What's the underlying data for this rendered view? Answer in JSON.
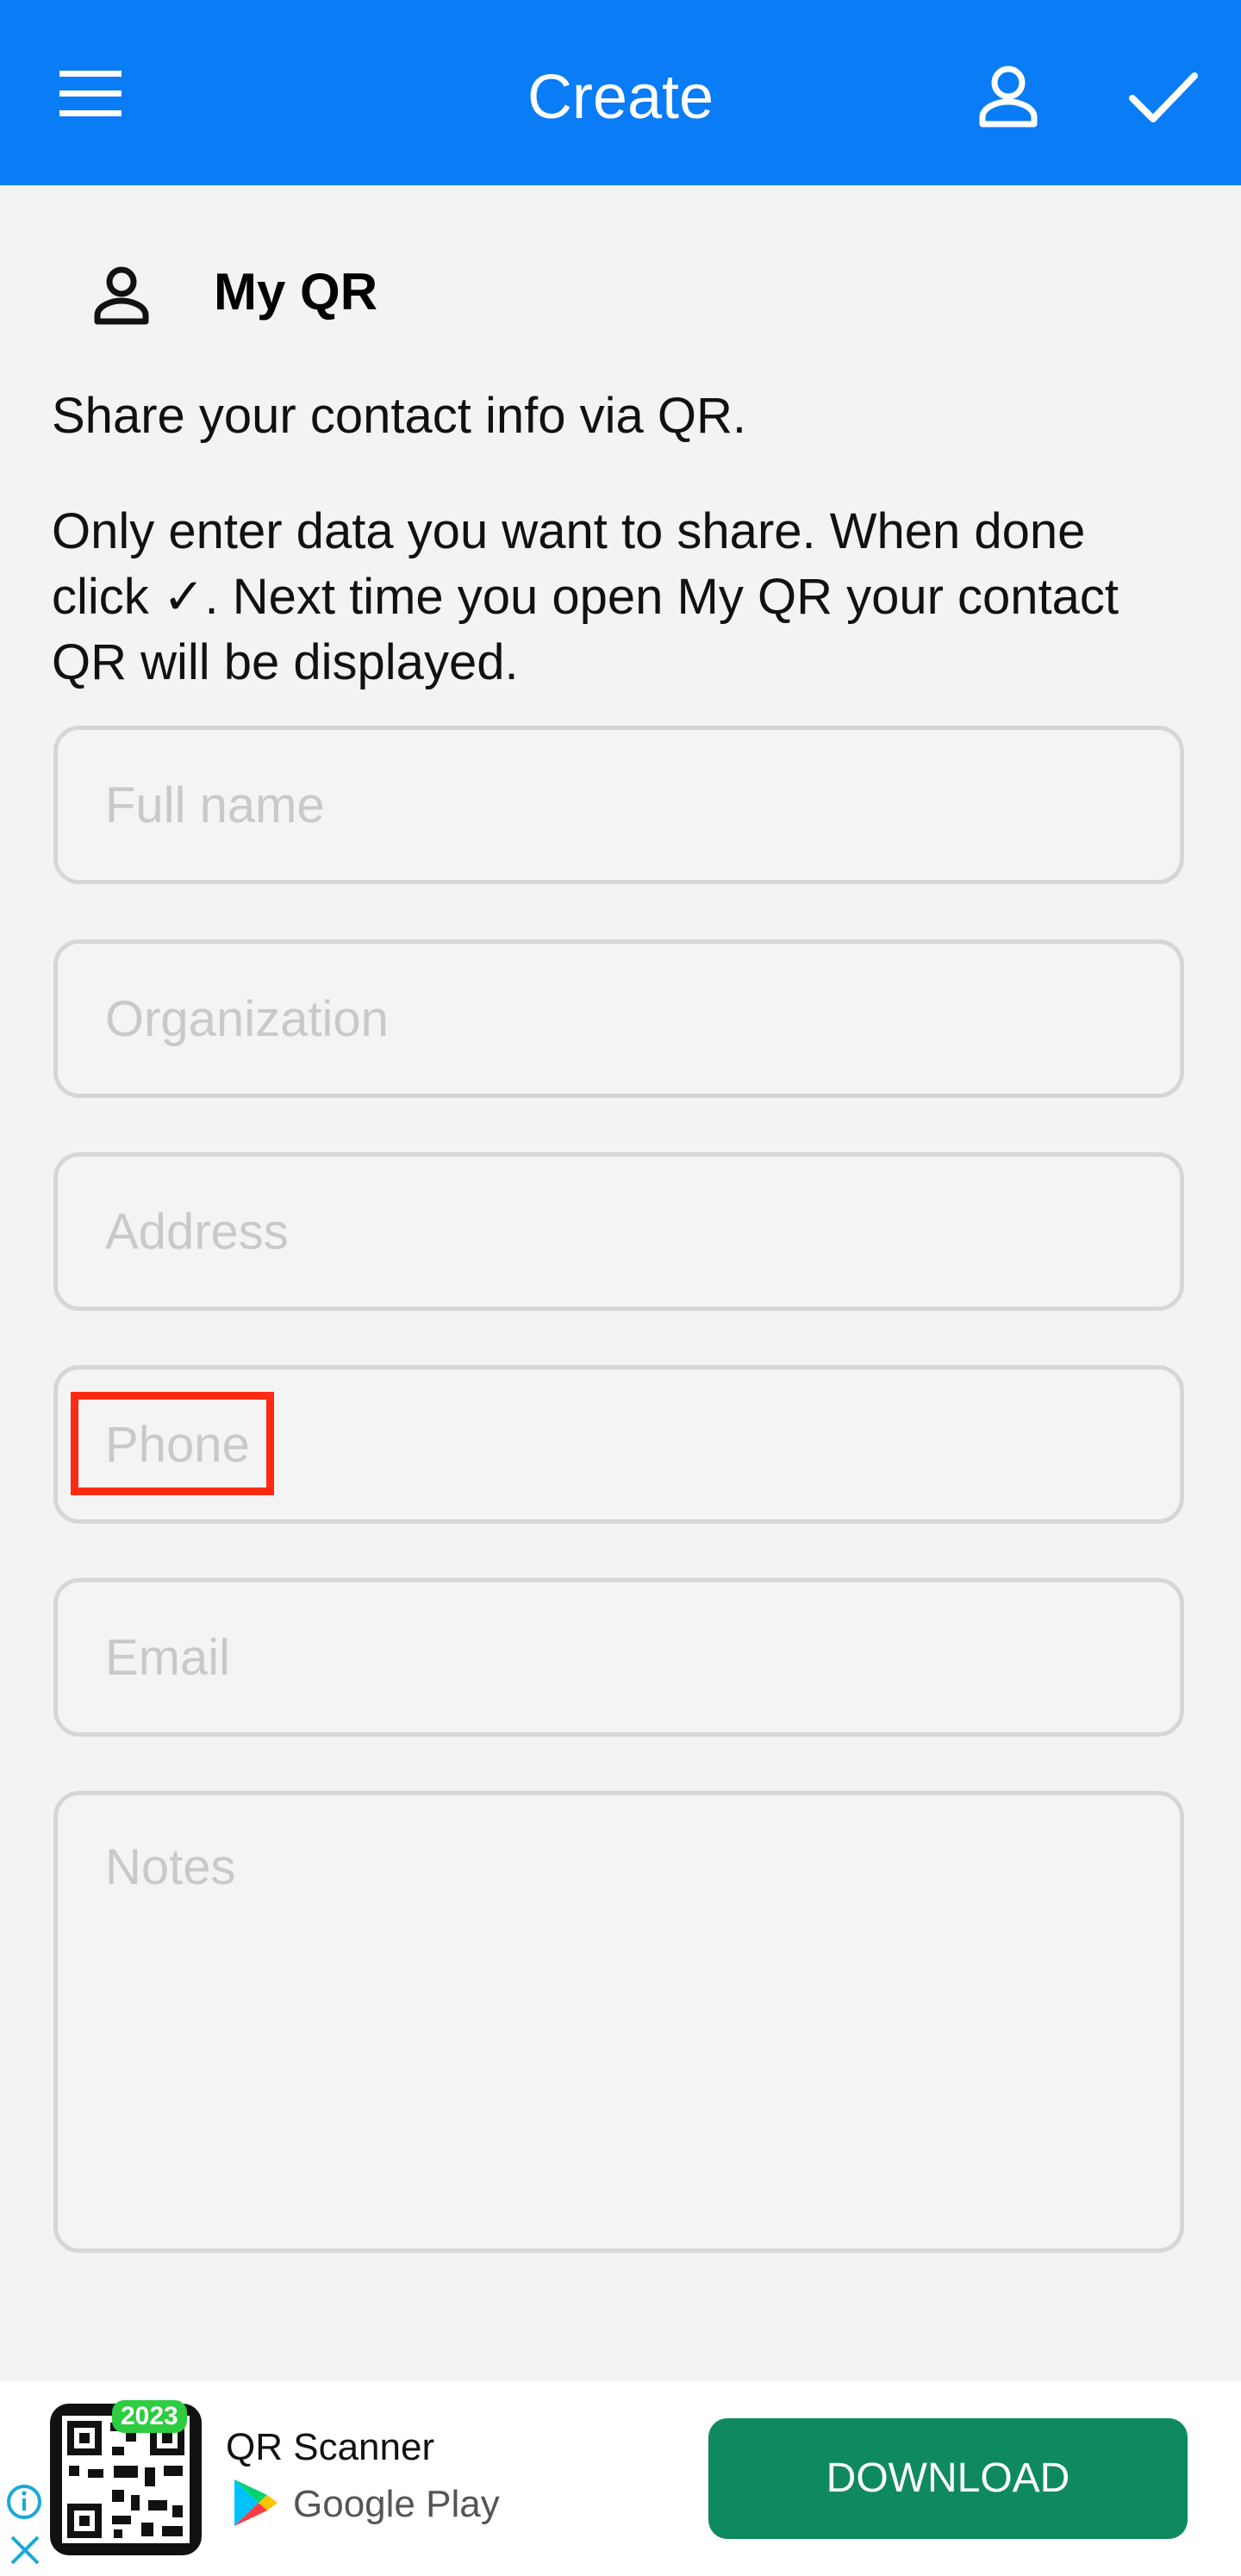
{
  "appbar": {
    "title": "Create",
    "icons": {
      "menu": "menu-icon",
      "profile": "person-icon",
      "confirm": "check-icon"
    },
    "color": "#0a7cf5"
  },
  "section": {
    "icon": "person-icon",
    "title": "My QR"
  },
  "intro": {
    "line1": "Share your contact info via QR.",
    "line2": "Only enter data you want to share. When done click ✓. Next time you open My QR your contact QR will be displayed."
  },
  "form": {
    "fields": [
      {
        "name": "full-name",
        "placeholder": "Full name",
        "value": ""
      },
      {
        "name": "organization",
        "placeholder": "Organization",
        "value": ""
      },
      {
        "name": "address",
        "placeholder": "Address",
        "value": ""
      },
      {
        "name": "phone",
        "placeholder": "Phone",
        "value": ""
      },
      {
        "name": "email",
        "placeholder": "Email",
        "value": ""
      },
      {
        "name": "notes",
        "placeholder": "Notes",
        "value": ""
      }
    ]
  },
  "ad": {
    "badge": "2023",
    "app_name": "QR Scanner",
    "store": "Google Play",
    "button": "DOWNLOAD",
    "button_color": "#0f8a5f",
    "icons": {
      "info": "info-icon",
      "close": "close-icon",
      "store": "google-play-icon"
    }
  }
}
